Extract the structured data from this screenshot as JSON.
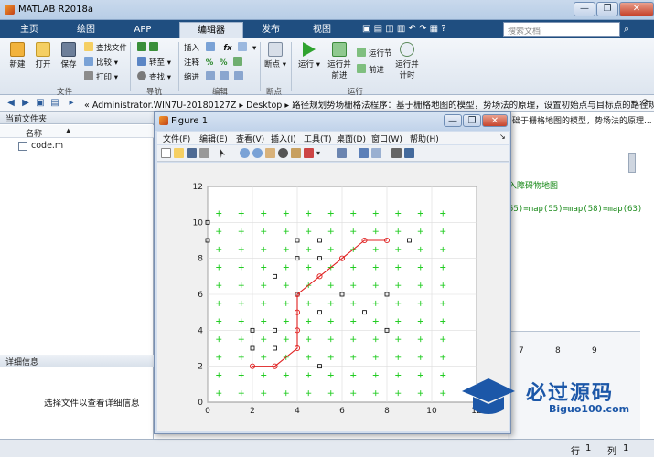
{
  "window": {
    "title": "MATLAB R2018a",
    "controls": [
      "—",
      "❐",
      "✕"
    ]
  },
  "tabs": [
    {
      "label": "主页"
    },
    {
      "label": "绘图"
    },
    {
      "label": "APP"
    },
    {
      "label": "编辑器"
    },
    {
      "label": "发布"
    },
    {
      "label": "视图"
    }
  ],
  "search": {
    "placeholder": "搜索文档"
  },
  "ribbon": {
    "file": {
      "new": "新建",
      "open": "打开",
      "save": "保存",
      "find_files": "查找文件",
      "compare": "比较",
      "print": "打印",
      "group": "文件"
    },
    "nav": {
      "goto": "转至",
      "find": "查找",
      "group": "导航"
    },
    "edit": {
      "insert": "插入",
      "comment": "注释",
      "indent": "缩进",
      "group": "编辑"
    },
    "breakpoints": {
      "label": "断点",
      "group": "断点"
    },
    "run": {
      "run": "运行",
      "run_advance": "运行并前进",
      "run_section": "运行节",
      "advance": "前进",
      "run_time": "运行并计时",
      "group": "运行"
    }
  },
  "address": {
    "path": "« Administrator.WIN7U-20180127Z ▸ Desktop ▸ 路径规划势场栅格法程序：基于栅格地图的模型，势场法的原理，设置初始点与目标点的路径规划图"
  },
  "current_folder": {
    "header": "当前文件夹",
    "col_name": "名称",
    "col_sort": "▲",
    "files": [
      "code.m"
    ]
  },
  "details": {
    "header": "详细信息",
    "hint": "选择文件以查看详细信息"
  },
  "command": {
    "header_tail": "础于栅格地图的模型，势场法的原理...",
    "line1": "入障碍物地图",
    "line2": "55)=map(55)=map(58)=map(63)"
  },
  "workspace_cols": [
    "7",
    "8",
    "9"
  ],
  "status": {
    "row_label": "行",
    "row": "1",
    "col_label": "列",
    "col": "1"
  },
  "figure": {
    "title": "Figure 1",
    "menu": [
      "文件(F)",
      "编辑(E)",
      "查看(V)",
      "插入(I)",
      "工具(T)",
      "桌面(D)",
      "窗口(W)",
      "帮助(H)"
    ]
  },
  "watermark": {
    "text": "必过源码",
    "sub": "Biguo100.com"
  },
  "colors": {
    "path": "#e02020",
    "grid_marker": "#22cc22",
    "obstacle": "#000000",
    "accent": "#1f4e80"
  },
  "chart_data": {
    "type": "scatter",
    "title": "",
    "xlabel": "",
    "ylabel": "",
    "xlim": [
      0,
      12
    ],
    "ylim": [
      0,
      12
    ],
    "xticks": [
      0,
      2,
      4,
      6,
      8,
      10,
      12
    ],
    "yticks": [
      0,
      2,
      4,
      6,
      8,
      10,
      12
    ],
    "grid": true,
    "series": [
      {
        "type": "line",
        "style": "red line with circle markers",
        "x": [
          2,
          3,
          4,
          4,
          4,
          4,
          5,
          6,
          7,
          8
        ],
        "y": [
          2,
          2,
          3,
          4,
          5,
          6,
          7,
          8,
          9,
          9
        ]
      },
      {
        "type": "scatter",
        "style": "black square markers",
        "x": [
          0,
          0,
          2,
          2,
          3,
          3,
          3,
          4,
          4,
          4,
          5,
          5,
          5,
          5,
          6,
          7,
          8,
          8,
          9
        ],
        "y": [
          9,
          10,
          3,
          4,
          3,
          4,
          7,
          6,
          8,
          9,
          2,
          5,
          8,
          9,
          6,
          5,
          4,
          6,
          9
        ]
      },
      {
        "type": "scatter",
        "style": "green plus markers on every integer grid point",
        "x_range": [
          0.5,
          10.5
        ],
        "y_range": [
          0.5,
          10.5
        ],
        "step": 1
      }
    ]
  }
}
